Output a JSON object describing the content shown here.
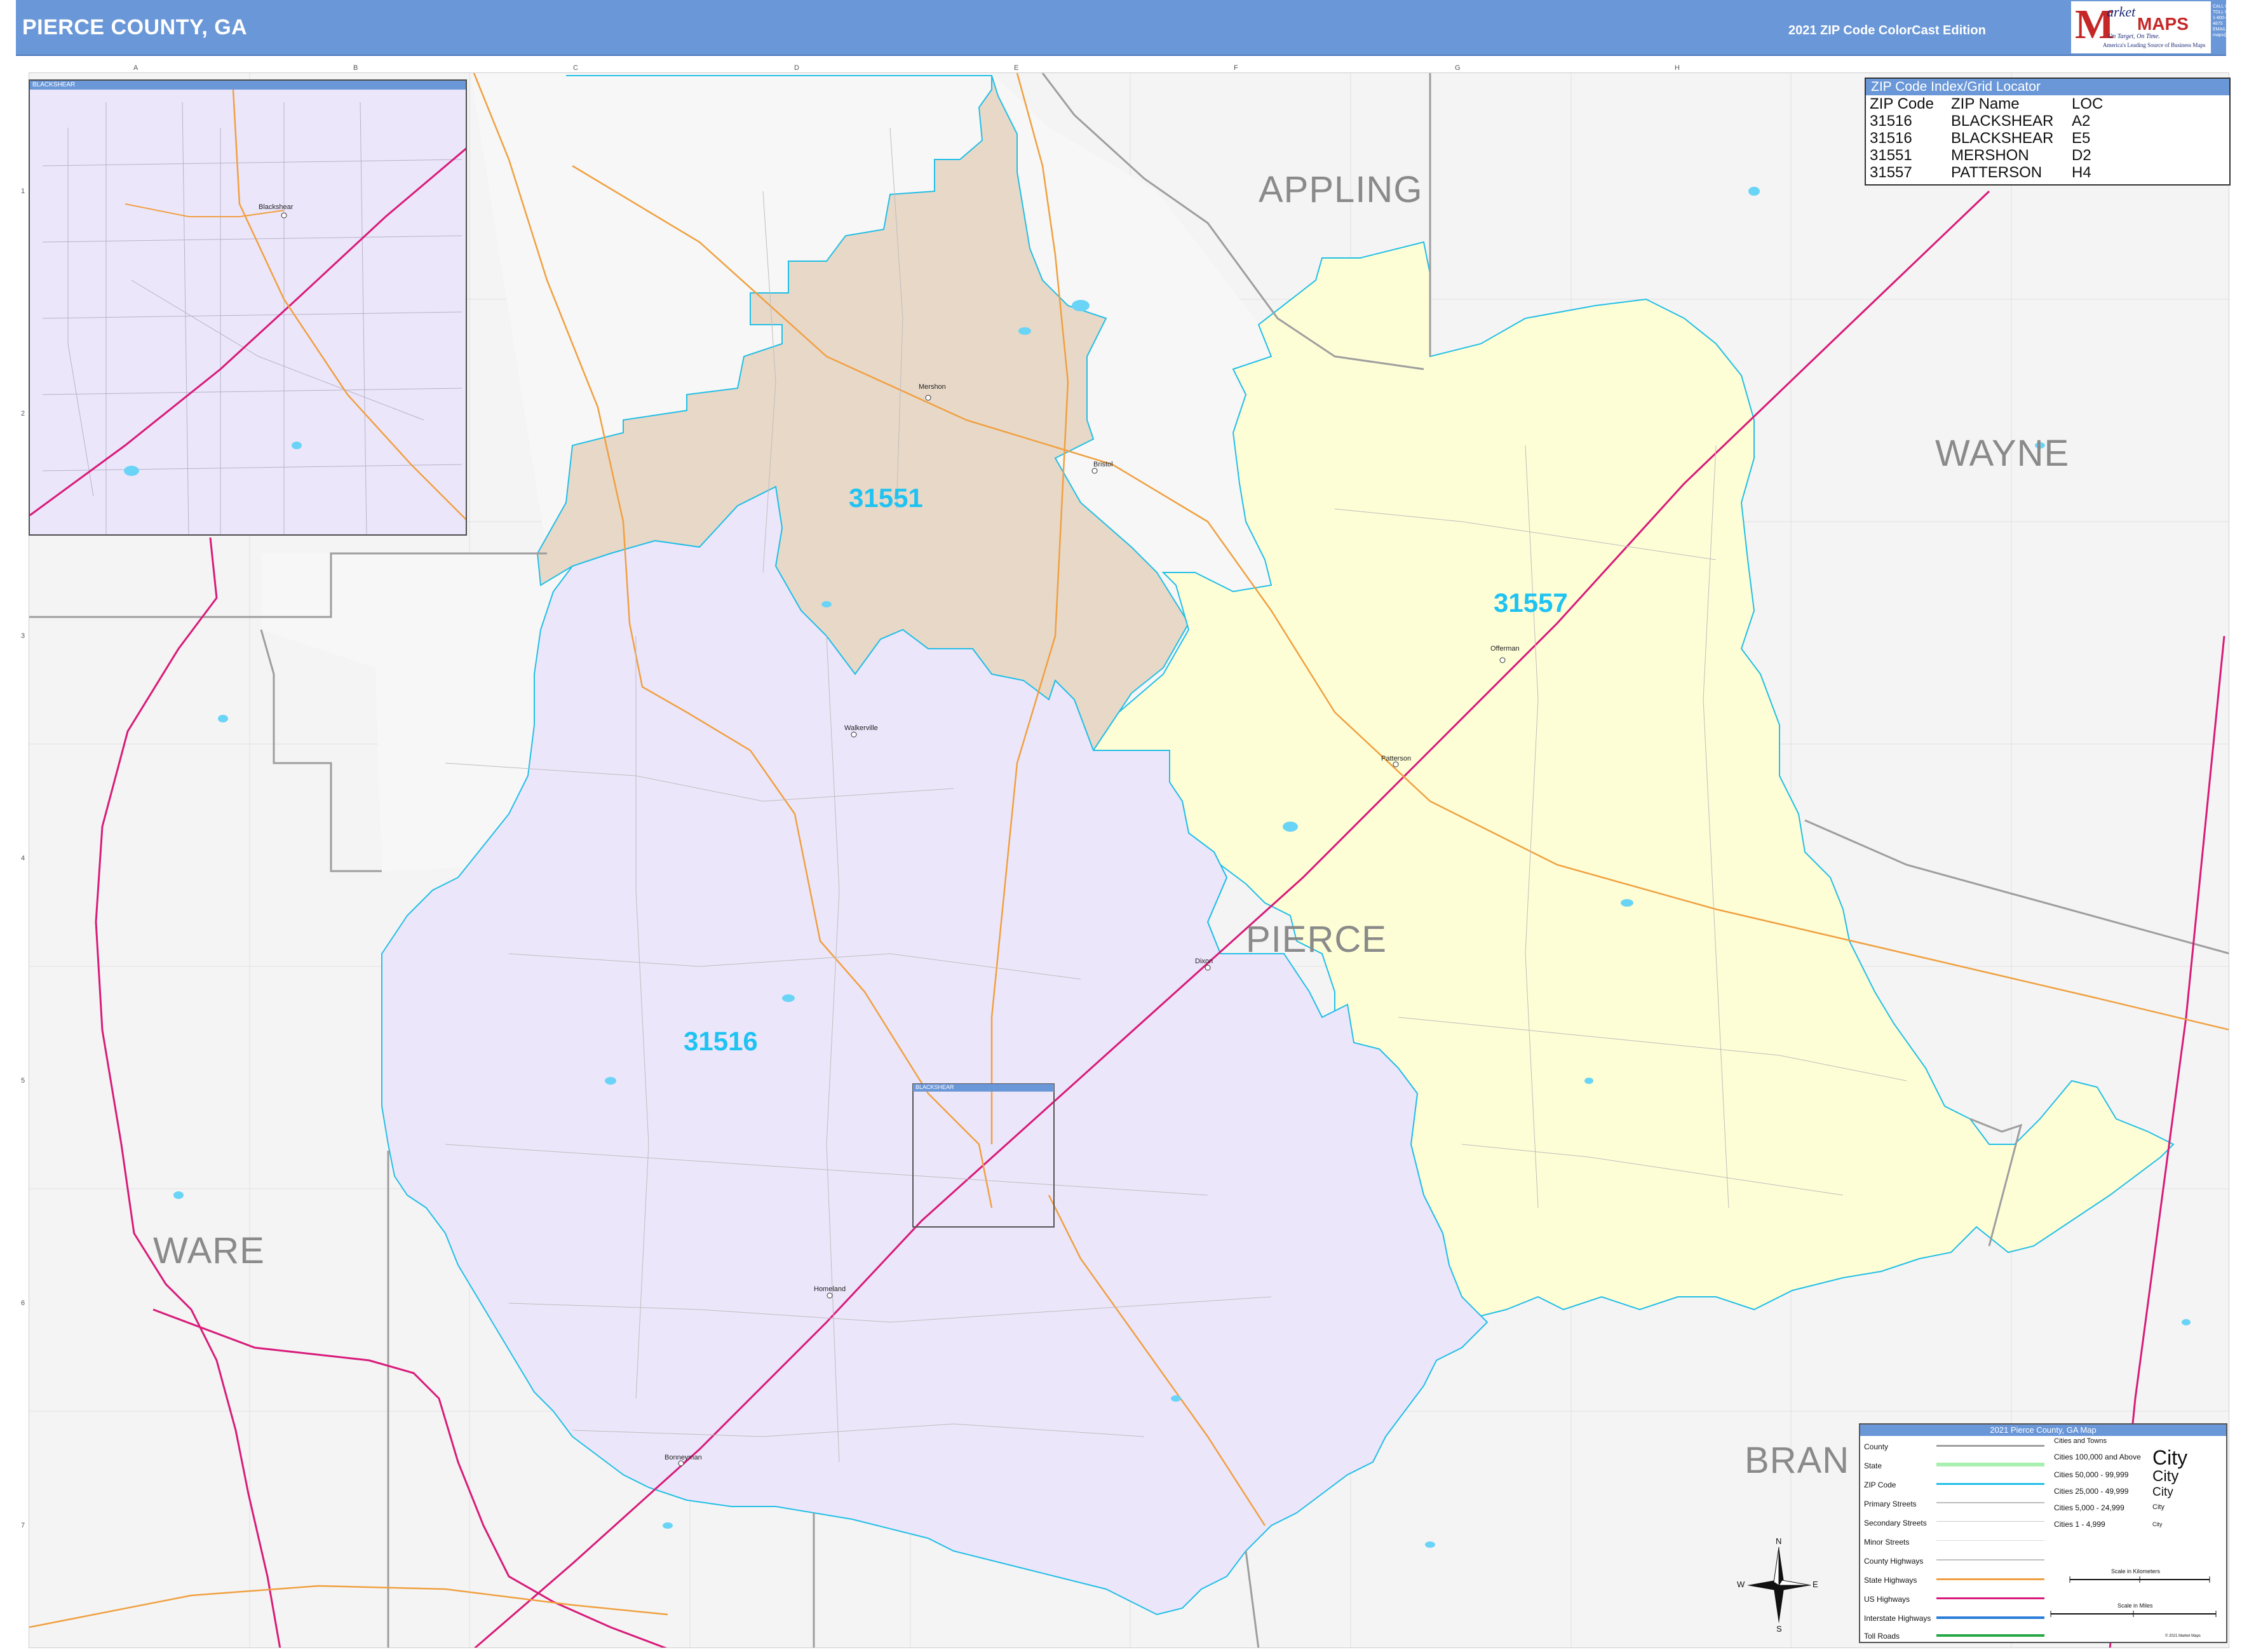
{
  "header": {
    "title": "PIERCE COUNTY, GA",
    "edition": "2021 ZIP Code ColorCast Edition",
    "logo": {
      "letter": "M",
      "word1": "arket",
      "word2": "MAPS",
      "slogan": "On Target, On Time.",
      "tagline": "America's Leading Source of Business Maps"
    },
    "contact": [
      "CALL US TOLL FREE",
      "1-800-848-4875",
      "EMAIL US AT",
      "maps@marketmaps.com"
    ]
  },
  "grid": {
    "columns": [
      "A",
      "B",
      "C",
      "D",
      "E",
      "F",
      "G",
      "H"
    ],
    "rows": [
      "1",
      "2",
      "3",
      "4",
      "5",
      "6",
      "7"
    ]
  },
  "inset": {
    "title": "BLACKSHEAR",
    "town": "Blackshear"
  },
  "zip_index": {
    "title": "ZIP Code Index/Grid Locator",
    "headers": [
      "ZIP Code",
      "ZIP Name",
      "LOC"
    ],
    "rows": [
      [
        "31516",
        "BLACKSHEAR",
        "A2"
      ],
      [
        "31516",
        "BLACKSHEAR",
        "E5"
      ],
      [
        "31551",
        "MERSHON",
        "D2"
      ],
      [
        "31557",
        "PATTERSON",
        "H4"
      ]
    ]
  },
  "counties": {
    "appling": "APPLING",
    "wayne": "WAYNE",
    "pierce": "PIERCE",
    "ware": "WARE",
    "brantley": "BRAN"
  },
  "zips": {
    "z31551": "31551",
    "z31557": "31557",
    "z31516": "31516"
  },
  "zip_colors": {
    "31551": "#e8d8c8",
    "31557": "#fefed6",
    "31516": "#ece6fb"
  },
  "towns": {
    "mershon": "Mershon",
    "bristol": "Bristol",
    "offerman": "Offerman",
    "patterson": "Patterson",
    "walkerville": "Walkerville",
    "dixon": "Dixon",
    "blackshear_box": "BLACKSHEAR",
    "homeland": "Homeland",
    "bonneyman": "Bonneyman"
  },
  "legend": {
    "title": "2021 Pierce County, GA Map",
    "items": [
      "County",
      "State",
      "ZIP Code",
      "Primary Streets",
      "Secondary Streets",
      "Minor Streets",
      "County Highways",
      "State Highways",
      "US Highways",
      "Interstate Highways",
      "Toll Roads"
    ],
    "cities_title": "Cities and Towns",
    "city_classes": [
      "Cities 100,000 and Above",
      "Cities 50,000 - 99,999",
      "Cities 25,000 - 49,999",
      "Cities 5,000 - 24,999",
      "Cities 1 - 4,999"
    ],
    "city_sample": "City",
    "scale_km": "Scale in Kilometers",
    "scale_mi": "Scale in Miles",
    "copyright": "© 2021 Market Maps"
  },
  "compass": {
    "n": "N",
    "s": "S",
    "e": "E",
    "w": "W"
  },
  "colors": {
    "header": "#6a97d8",
    "zip_boundary": "#22bfe6",
    "county_line": "#a0a0a0",
    "us_highway": "#d81b7a",
    "state_highway": "#f0a040",
    "water": "#6ad4f6"
  }
}
